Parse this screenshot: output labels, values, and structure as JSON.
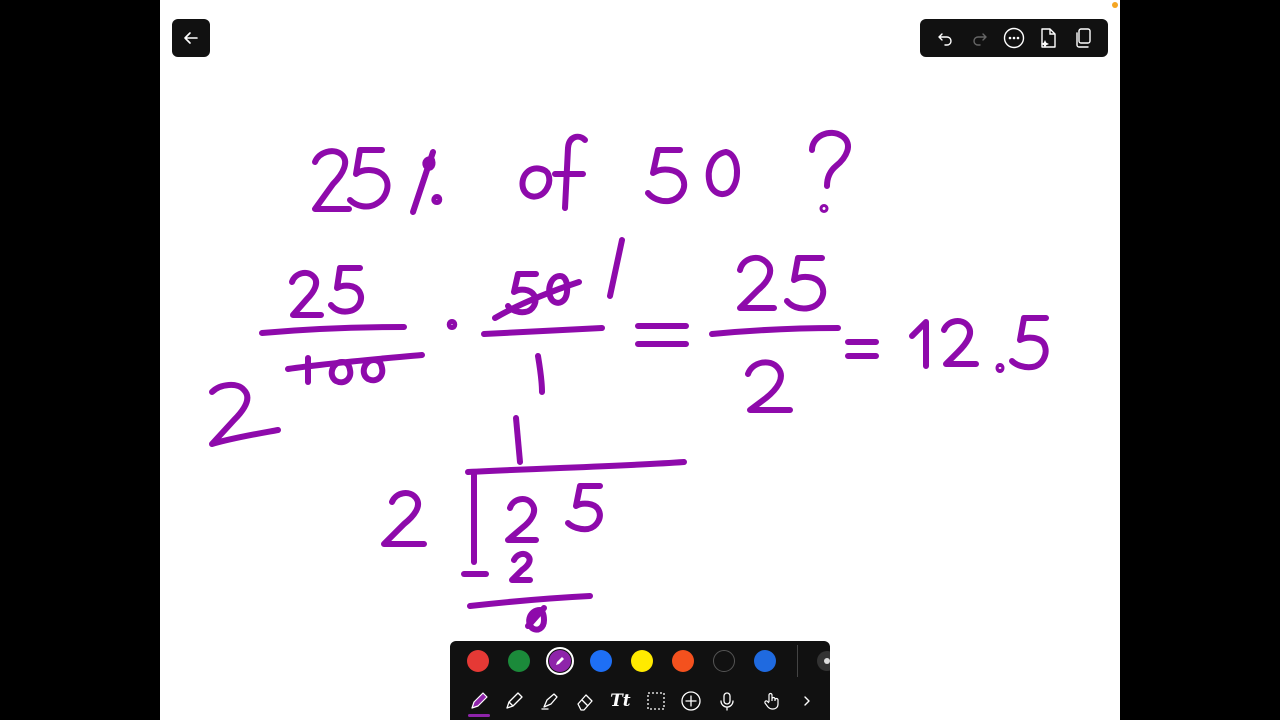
{
  "app": {
    "accent": "#8e24aa",
    "ink_color": "#8e0aab"
  },
  "top_toolbar": {
    "buttons": [
      "undo-icon",
      "redo-icon",
      "more-icon",
      "ai-doc-icon",
      "pages-icon"
    ]
  },
  "palette": {
    "colors": [
      "#e53935",
      "#1b8a3a",
      "#8e24aa",
      "#1e6ff5",
      "#ffea00",
      "#f4511e",
      "#111111",
      "#1f6ae0"
    ],
    "selected_index": 2
  },
  "tools": [
    "pen-icon",
    "pencil-icon",
    "highlighter-icon",
    "eraser-icon",
    "text-tool",
    "lasso-select-icon",
    "add-icon",
    "microphone-icon",
    "hand-touch-icon",
    "chevron-right-icon"
  ],
  "tool_text_label": "Tt",
  "handwriting": {
    "question": "25% of 50 ?",
    "line1_left_numerator": "25",
    "line1_left_denominator": "100",
    "line1_times_numerator": "50",
    "line1_times_denominator": "1",
    "result_numerator": "25",
    "result_denominator": "2",
    "result_decimal": "12.5",
    "division_divisor": "2",
    "division_dividend": "25",
    "division_quotient": "1",
    "division_subtract": "-2",
    "division_remainder": "0"
  }
}
